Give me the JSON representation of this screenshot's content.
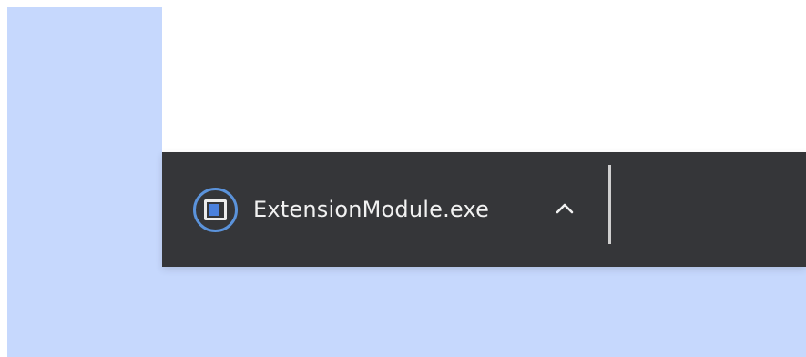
{
  "download_shelf": {
    "items": [
      {
        "filename": "ExtensionModule.exe",
        "icon": "exe-file-icon",
        "action_icon": "chevron-up-icon"
      }
    ]
  },
  "colors": {
    "desktop_background": "#c6d8fd",
    "shelf_background": "#353639",
    "icon_ring": "#5b93db",
    "file_icon_fill": "#4a80dc",
    "text": "#f1f1f1"
  }
}
